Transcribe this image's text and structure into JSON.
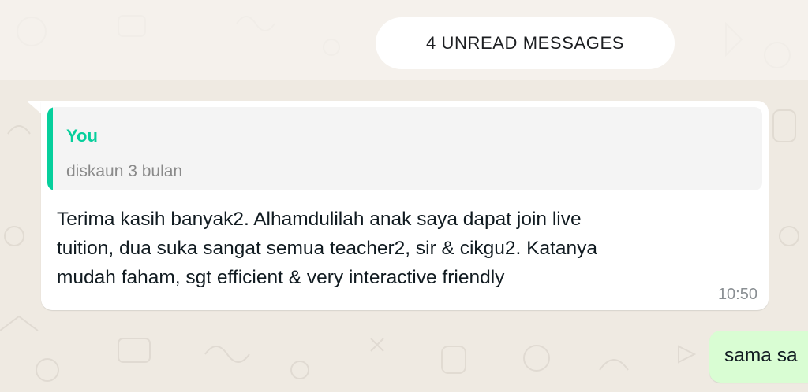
{
  "unread_divider": {
    "label": "4 UNREAD MESSAGES"
  },
  "incoming_message": {
    "quoted_reply": {
      "author": "You",
      "text": "diskaun 3 bulan"
    },
    "text": "Terima kasih banyak2. Alhamdulilah anak saya dapat join live\ntuition, dua suka sangat semua teacher2, sir & cikgu2. Katanya\nmudah faham, sgt efficient & very interactive friendly",
    "time": "10:50"
  },
  "outgoing_message": {
    "text": "sama sa"
  },
  "colors": {
    "chat_background": "#efeae2",
    "incoming_bubble": "#ffffff",
    "outgoing_bubble": "#d9fdd3",
    "quote_accent": "#06cf9c"
  }
}
